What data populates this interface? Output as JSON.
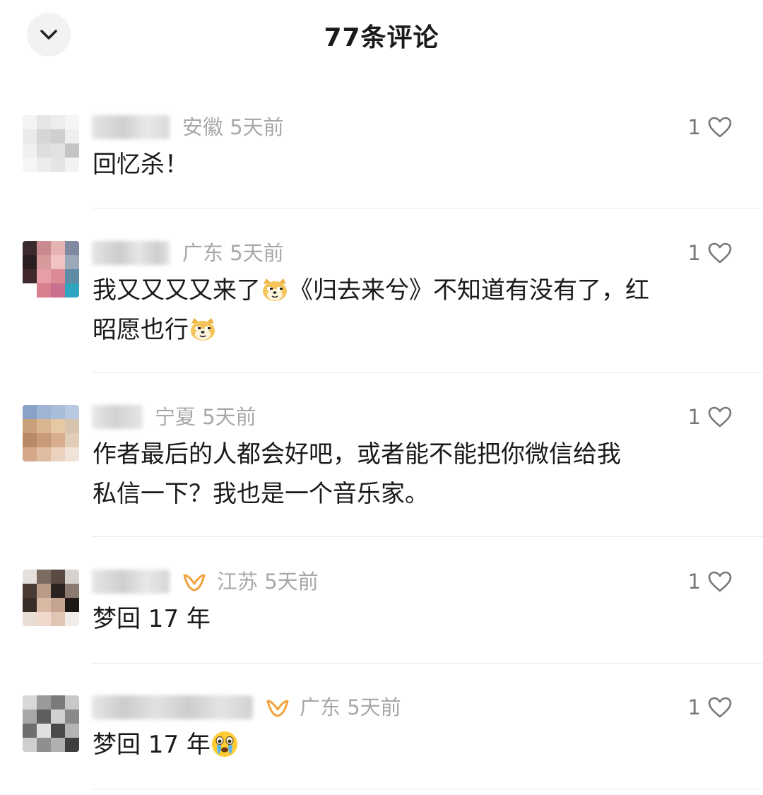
{
  "header": {
    "title": "77条评论",
    "collapse_icon": "chevron-down-icon"
  },
  "comments": [
    {
      "location": "安徽",
      "time": "5天前",
      "text": "回忆杀！",
      "likes": "1",
      "vip": false
    },
    {
      "location": "广东",
      "time": "5天前",
      "text_parts": [
        "我又又又又来了",
        "《归去来兮》不知道有没有了，红\n昭愿也行",
        ""
      ],
      "likes": "1",
      "vip": false,
      "emoji": "doge-cat-emoji"
    },
    {
      "location": "宁夏",
      "time": "5天前",
      "text": "作者最后的人都会好吧，或者能不能把你微信给我\n私信一下？我也是一个音乐家。",
      "likes": "1",
      "vip": false
    },
    {
      "location": "江苏",
      "time": "5天前",
      "text": "梦回 17 年",
      "likes": "1",
      "vip": true
    },
    {
      "location": "广东",
      "time": "5天前",
      "text": "梦回 17 年",
      "likes": "1",
      "vip": true,
      "emoji": "crying-face-emoji"
    }
  ],
  "colors": {
    "meta": "#a8a8a8",
    "vip_badge": "#f0a23c",
    "text": "#1a1a1a",
    "divider": "#e8e8e8"
  }
}
